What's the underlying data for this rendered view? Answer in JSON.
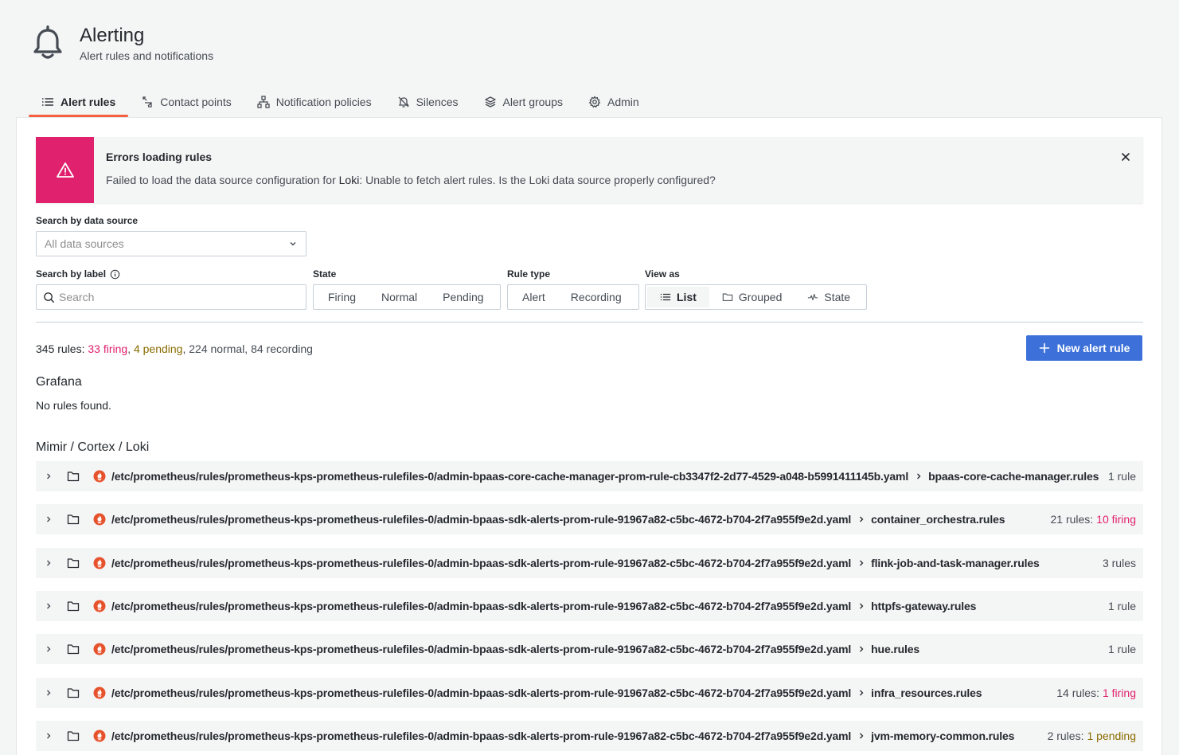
{
  "header": {
    "title": "Alerting",
    "subtitle": "Alert rules and notifications",
    "icon": "bell-icon"
  },
  "tabs": [
    {
      "label": "Alert rules",
      "icon": "list-icon",
      "active": true
    },
    {
      "label": "Contact points",
      "icon": "contact-icon",
      "active": false
    },
    {
      "label": "Notification policies",
      "icon": "sitemap-icon",
      "active": false
    },
    {
      "label": "Silences",
      "icon": "bell-slash-icon",
      "active": false
    },
    {
      "label": "Alert groups",
      "icon": "layer-group-icon",
      "active": false
    },
    {
      "label": "Admin",
      "icon": "cog-icon",
      "active": false
    }
  ],
  "error_alert": {
    "title": "Errors loading rules",
    "message_prefix": "Failed to load the data source configuration for ",
    "datasource": "Loki",
    "message_suffix": ": Unable to fetch alert rules. Is the Loki data source properly configured?",
    "color": "#e0226e"
  },
  "filters": {
    "datasource_label": "Search by data source",
    "datasource_placeholder": "All data sources",
    "label_label": "Search by label",
    "search_placeholder": "Search",
    "state_label": "State",
    "state_options": [
      "Firing",
      "Normal",
      "Pending"
    ],
    "rule_type_label": "Rule type",
    "rule_type_options": [
      "Alert",
      "Recording"
    ],
    "view_label": "View as",
    "view_options": [
      "List",
      "Grouped",
      "State"
    ],
    "view_selected": "List"
  },
  "summary": {
    "total": "345 rules:",
    "firing": "33 firing",
    "pending": "4 pending",
    "rest": ", 224 normal, 84 recording",
    "comma": ","
  },
  "new_rule_button": "New alert rule",
  "grafana_section": {
    "title": "Grafana",
    "empty": "No rules found."
  },
  "mimir_section": {
    "title": "Mimir / Cortex / Loki",
    "rows": [
      {
        "path": "/etc/prometheus/rules/prometheus-kps-prometheus-rulefiles-0/admin-bpaas-core-cache-manager-prom-rule-cb3347f2-2d77-4529-a048-b5991411145b.yaml",
        "group": "bpaas-core-cache-manager.rules",
        "count": "1 rule",
        "state": ""
      },
      {
        "path": "/etc/prometheus/rules/prometheus-kps-prometheus-rulefiles-0/admin-bpaas-sdk-alerts-prom-rule-91967a82-c5bc-4672-b704-2f7a955f9e2d.yaml",
        "group": "container_orchestra.rules",
        "count": "21 rules:",
        "state": "10 firing",
        "state_kind": "firing"
      },
      {
        "path": "/etc/prometheus/rules/prometheus-kps-prometheus-rulefiles-0/admin-bpaas-sdk-alerts-prom-rule-91967a82-c5bc-4672-b704-2f7a955f9e2d.yaml",
        "group": "flink-job-and-task-manager.rules",
        "count": "3 rules",
        "state": ""
      },
      {
        "path": "/etc/prometheus/rules/prometheus-kps-prometheus-rulefiles-0/admin-bpaas-sdk-alerts-prom-rule-91967a82-c5bc-4672-b704-2f7a955f9e2d.yaml",
        "group": "httpfs-gateway.rules",
        "count": "1 rule",
        "state": ""
      },
      {
        "path": "/etc/prometheus/rules/prometheus-kps-prometheus-rulefiles-0/admin-bpaas-sdk-alerts-prom-rule-91967a82-c5bc-4672-b704-2f7a955f9e2d.yaml",
        "group": "hue.rules",
        "count": "1 rule",
        "state": ""
      },
      {
        "path": "/etc/prometheus/rules/prometheus-kps-prometheus-rulefiles-0/admin-bpaas-sdk-alerts-prom-rule-91967a82-c5bc-4672-b704-2f7a955f9e2d.yaml",
        "group": "infra_resources.rules",
        "count": "14 rules:",
        "state": "1 firing",
        "state_kind": "firing"
      },
      {
        "path": "/etc/prometheus/rules/prometheus-kps-prometheus-rulefiles-0/admin-bpaas-sdk-alerts-prom-rule-91967a82-c5bc-4672-b704-2f7a955f9e2d.yaml",
        "group": "jvm-memory-common.rules",
        "count": "2 rules:",
        "state": "1 pending",
        "state_kind": "pending"
      }
    ]
  },
  "colors": {
    "primary": "#3d71d9",
    "firing": "#e0226e",
    "pending": "#8a6c00",
    "tab_underline": "#f55f3e",
    "prometheus": "#e6522c"
  }
}
